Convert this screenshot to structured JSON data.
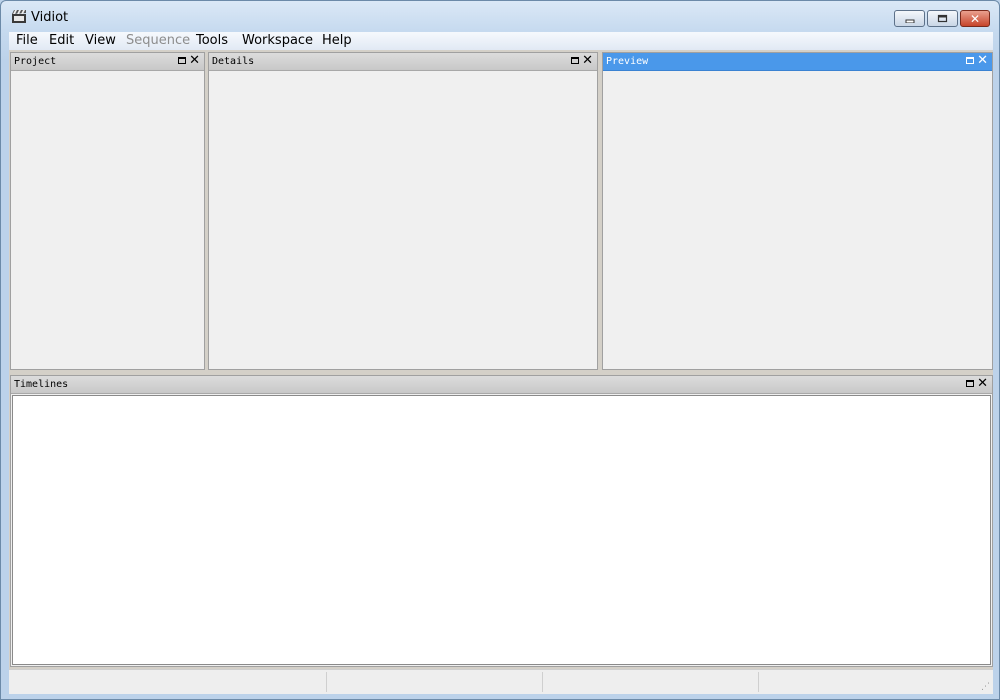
{
  "window": {
    "title": "Vidiot",
    "app_icon": "clapperboard-icon"
  },
  "title_buttons": {
    "minimize": "minimize-icon",
    "maximize": "restore-icon",
    "close": "close-icon",
    "close_glyph": "✕"
  },
  "menu": {
    "items": [
      {
        "label": "File",
        "enabled": true
      },
      {
        "label": "Edit",
        "enabled": true
      },
      {
        "label": "View",
        "enabled": true
      },
      {
        "label": "Sequence",
        "enabled": false
      },
      {
        "label": "Tools",
        "enabled": true
      },
      {
        "label": "Workspace",
        "enabled": true
      },
      {
        "label": "Help",
        "enabled": true
      }
    ]
  },
  "panes": {
    "project": {
      "title": "Project",
      "active": false
    },
    "details": {
      "title": "Details",
      "active": false
    },
    "preview": {
      "title": "Preview",
      "active": true
    },
    "timelines": {
      "title": "Timelines",
      "active": false
    }
  },
  "pane_controls": {
    "maximize_icon": "pane-maximize-icon",
    "close_glyph": "✕"
  },
  "status_bar": {
    "fields": [
      "",
      "",
      "",
      ""
    ]
  },
  "colors": {
    "active_pane_header": "#4a98ea",
    "title_gradient_top": "#dbe8f6",
    "close_button": "#c7452b"
  }
}
